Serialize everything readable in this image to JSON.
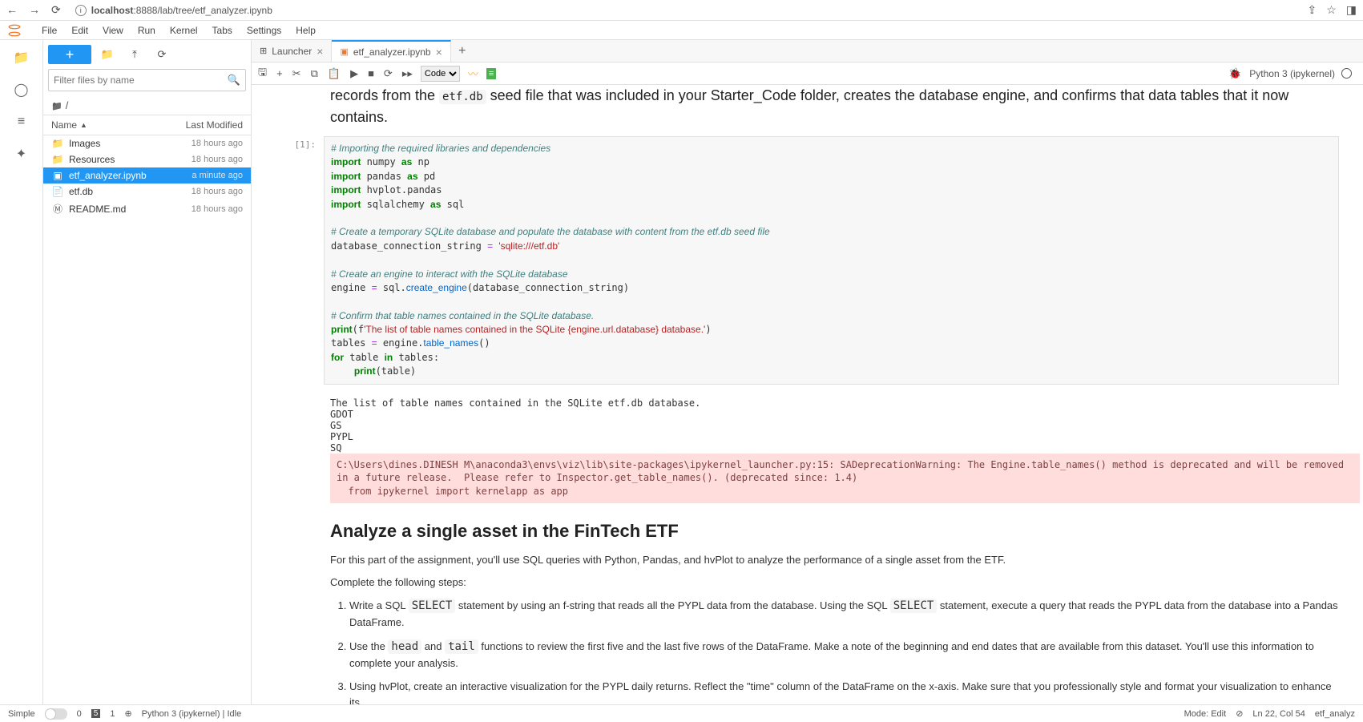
{
  "browser": {
    "url_host": "localhost",
    "url_rest": ":8888/lab/tree/etf_analyzer.ipynb"
  },
  "menu": {
    "items": [
      "File",
      "Edit",
      "View",
      "Run",
      "Kernel",
      "Tabs",
      "Settings",
      "Help"
    ]
  },
  "file_panel": {
    "filter_placeholder": "Filter files by name",
    "breadcrumb": "/",
    "header_name": "Name",
    "header_sort": "▲",
    "header_mod": "Last Modified",
    "items": [
      {
        "icon": "folder",
        "name": "Images",
        "mod": "18 hours ago",
        "selected": false
      },
      {
        "icon": "folder",
        "name": "Resources",
        "mod": "18 hours ago",
        "selected": false
      },
      {
        "icon": "notebook",
        "name": "etf_analyzer.ipynb",
        "mod": "a minute ago",
        "selected": true
      },
      {
        "icon": "file",
        "name": "etf.db",
        "mod": "18 hours ago",
        "selected": false
      },
      {
        "icon": "markdown",
        "name": "README.md",
        "mod": "18 hours ago",
        "selected": false
      }
    ]
  },
  "tabs": [
    {
      "icon": "⊞",
      "label": "Launcher",
      "active": false
    },
    {
      "icon": "▣",
      "label": "etf_analyzer.ipynb",
      "active": true
    }
  ],
  "nb_toolbar": {
    "cell_type": "Code",
    "kernel": "Python 3 (ipykernel)"
  },
  "markdown_top_prefix": "records from the ",
  "markdown_top_code": "etf.db",
  "markdown_top_suffix": " seed file that was included in your Starter_Code folder, creates the database engine, and confirms that data tables that it now contains.",
  "code_cell": {
    "prompt": "[1]:",
    "lines": [
      {
        "t": "cm",
        "v": "# Importing the required libraries and dependencies"
      },
      {
        "t": "import",
        "kw": "import",
        "m": " numpy ",
        "as": "as",
        "a": " np"
      },
      {
        "t": "import",
        "kw": "import",
        "m": " pandas ",
        "as": "as",
        "a": " pd"
      },
      {
        "t": "import",
        "kw": "import",
        "m": " hvplot.pandas"
      },
      {
        "t": "import",
        "kw": "import",
        "m": " sqlalchemy ",
        "as": "as",
        "a": " sql"
      },
      {
        "t": "blank"
      },
      {
        "t": "cm",
        "v": "# Create a temporary SQLite database and populate the database with content from the etf.db seed file"
      },
      {
        "t": "assign",
        "lhs": "database_connection_string ",
        "op": "=",
        "rhs": " ",
        "str": "'sqlite:///etf.db'"
      },
      {
        "t": "blank"
      },
      {
        "t": "cm",
        "v": "# Create an engine to interact with the SQLite database"
      },
      {
        "t": "engine",
        "lhs": "engine ",
        "op": "=",
        "rhs": " sql.",
        "fn": "create_engine",
        "args": "(database_connection_string)"
      },
      {
        "t": "blank"
      },
      {
        "t": "cm",
        "v": "# Confirm that table names contained in the SQLite database."
      },
      {
        "t": "print",
        "kw": "print",
        "open": "(",
        "fpre": "f",
        "str": "'The list of table names contained in the SQLite {engine.url.database} database.'",
        "close": ")"
      },
      {
        "t": "tables",
        "lhs": "tables ",
        "op": "=",
        "rhs": " engine.",
        "fn": "table_names",
        "args": "()"
      },
      {
        "t": "for",
        "kw": "for",
        "mid": " table ",
        "kw2": "in",
        "tail": " tables:"
      },
      {
        "t": "indent_print",
        "indent": "    ",
        "kw": "print",
        "args": "(table)"
      }
    ]
  },
  "output_text": "The list of table names contained in the SQLite etf.db database.\nGDOT\nGS\nPYPL\nSQ",
  "output_warn": "C:\\Users\\dines.DINESH M\\anaconda3\\envs\\viz\\lib\\site-packages\\ipykernel_launcher.py:15: SADeprecationWarning: The Engine.table_names() method is deprecated and will be removed in a future release.  Please refer to Inspector.get_table_names(). (deprecated since: 1.4)\n  from ipykernel import kernelapp as app",
  "md2": {
    "h2": "Analyze a single asset in the FinTech ETF",
    "p1": "For this part of the assignment, you'll use SQL queries with Python, Pandas, and hvPlot to analyze the performance of a single asset from the ETF.",
    "p2": "Complete the following steps:",
    "li1_a": "Write a SQL ",
    "li1_code1": "SELECT",
    "li1_b": " statement by using an f-string that reads all the PYPL data from the database. Using the SQL ",
    "li1_code2": "SELECT",
    "li1_c": " statement, execute a query that reads the PYPL data from the database into a Pandas DataFrame.",
    "li2_a": "Use the ",
    "li2_code1": "head",
    "li2_b": " and ",
    "li2_code2": "tail",
    "li2_c": " functions to review the first five and the last five rows of the DataFrame. Make a note of the beginning and end dates that are available from this dataset. You'll use this information to complete your analysis.",
    "li3": "Using hvPlot, create an interactive visualization for the PYPL daily returns. Reflect the \"time\" column of the DataFrame on the x-axis. Make sure that you professionally style and format your visualization to enhance its"
  },
  "status": {
    "simple": "Simple",
    "zero": "0",
    "five": "5",
    "one": "1",
    "kernel": "Python 3 (ipykernel) | Idle",
    "mode": "Mode: Edit",
    "ln": "Ln 22, Col 54",
    "file": "etf_analyz"
  }
}
